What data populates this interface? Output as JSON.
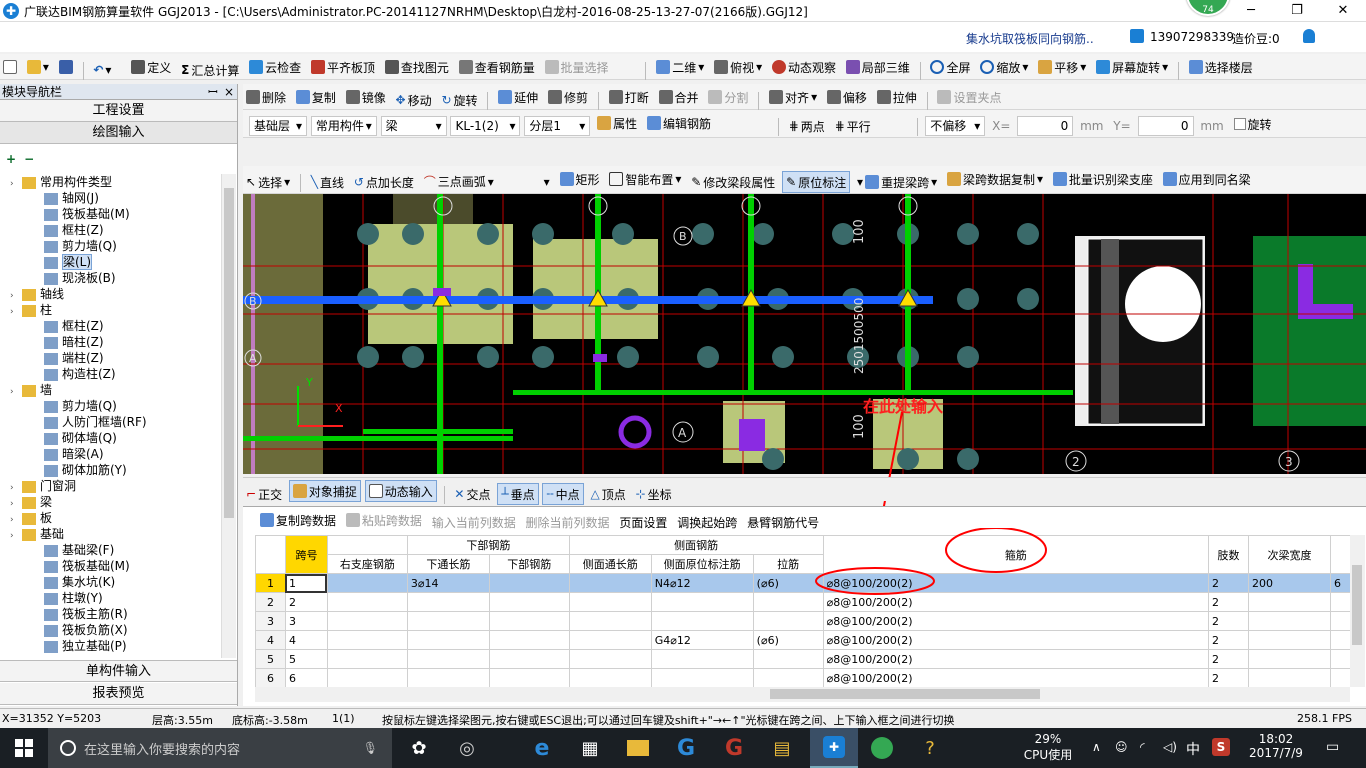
{
  "window": {
    "title": "广联达BIM钢筋算量软件 GGJ2013 - [C:\\Users\\Administrator.PC-20141127NRHM\\Desktop\\白龙村-2016-08-25-13-27-07(2166版).GGJ12]",
    "badge": "74",
    "minimize": "─",
    "restore": "❐",
    "close": "✕"
  },
  "info": {
    "link": "集水坑取筏板同向钢筋..",
    "phone": "13907298339",
    "beans": "造价豆:0"
  },
  "toolbar1": [
    {
      "label": "定义"
    },
    {
      "label": "汇总计算"
    },
    {
      "label": "云检查"
    },
    {
      "label": "平齐板顶"
    },
    {
      "label": "查找图元"
    },
    {
      "label": "查看钢筋量"
    },
    {
      "label": "批量选择"
    },
    {
      "label": "二维"
    },
    {
      "label": "俯视"
    },
    {
      "label": "动态观察"
    },
    {
      "label": "局部三维"
    },
    {
      "label": "全屏"
    },
    {
      "label": "缩放"
    },
    {
      "label": "平移"
    },
    {
      "label": "屏幕旋转"
    },
    {
      "label": "选择楼层"
    }
  ],
  "toolbar2": [
    {
      "label": "删除"
    },
    {
      "label": "复制"
    },
    {
      "label": "镜像"
    },
    {
      "label": "移动"
    },
    {
      "label": "旋转"
    },
    {
      "label": "延伸"
    },
    {
      "label": "修剪"
    },
    {
      "label": "打断"
    },
    {
      "label": "合并"
    },
    {
      "label": "分割"
    },
    {
      "label": "对齐"
    },
    {
      "label": "偏移"
    },
    {
      "label": "拉伸"
    },
    {
      "label": "设置夹点"
    }
  ],
  "toolbar3": {
    "floor": "基础层",
    "category": "常用构件",
    "type": "梁",
    "element": "KL-1(2)",
    "layer": "分层1",
    "props": "属性",
    "edit": "编辑钢筋",
    "twopoint": "两点",
    "parallel": "平行",
    "offset_mode": "不偏移",
    "x_label": "X=",
    "x_val": "0",
    "y_label": "Y=",
    "y_val": "0",
    "unit": "mm",
    "rotate": "旋转"
  },
  "toolbar4": [
    {
      "label": "选择"
    },
    {
      "label": "直线"
    },
    {
      "label": "点加长度"
    },
    {
      "label": "三点画弧"
    },
    {
      "label": "矩形"
    },
    {
      "label": "智能布置"
    },
    {
      "label": "修改梁段属性"
    },
    {
      "label": "原位标注"
    },
    {
      "label": "重提梁跨"
    },
    {
      "label": "梁跨数据复制"
    },
    {
      "label": "批量识别梁支座"
    },
    {
      "label": "应用到同名梁"
    }
  ],
  "leftpanel": {
    "header": "模块导航栏",
    "pin": "ꟷ",
    "close": "×",
    "eng_settings": "工程设置",
    "draw_input": "绘图输入",
    "single_input": "单构件输入",
    "report": "报表预览",
    "tree": [
      {
        "label": "常用构件类型",
        "level": 0,
        "folder": true
      },
      {
        "label": "轴网(J)",
        "level": 1
      },
      {
        "label": "筏板基础(M)",
        "level": 1
      },
      {
        "label": "框柱(Z)",
        "level": 1
      },
      {
        "label": "剪力墙(Q)",
        "level": 1
      },
      {
        "label": "梁(L)",
        "level": 1,
        "selected": true
      },
      {
        "label": "现浇板(B)",
        "level": 1
      },
      {
        "label": "轴线",
        "level": 0,
        "folder": true
      },
      {
        "label": "柱",
        "level": 0,
        "folder": true
      },
      {
        "label": "框柱(Z)",
        "level": 1
      },
      {
        "label": "暗柱(Z)",
        "level": 1
      },
      {
        "label": "端柱(Z)",
        "level": 1
      },
      {
        "label": "构造柱(Z)",
        "level": 1
      },
      {
        "label": "墙",
        "level": 0,
        "folder": true
      },
      {
        "label": "剪力墙(Q)",
        "level": 1
      },
      {
        "label": "人防门框墙(RF)",
        "level": 1
      },
      {
        "label": "砌体墙(Q)",
        "level": 1
      },
      {
        "label": "暗梁(A)",
        "level": 1
      },
      {
        "label": "砌体加筋(Y)",
        "level": 1
      },
      {
        "label": "门窗洞",
        "level": 0,
        "folder": true
      },
      {
        "label": "梁",
        "level": 0,
        "folder": true
      },
      {
        "label": "板",
        "level": 0,
        "folder": true
      },
      {
        "label": "基础",
        "level": 0,
        "folder": true
      },
      {
        "label": "基础梁(F)",
        "level": 1
      },
      {
        "label": "筏板基础(M)",
        "level": 1
      },
      {
        "label": "集水坑(K)",
        "level": 1
      },
      {
        "label": "柱墩(Y)",
        "level": 1
      },
      {
        "label": "筏板主筋(R)",
        "level": 1
      },
      {
        "label": "筏板负筋(X)",
        "level": 1
      },
      {
        "label": "独立基础(P)",
        "level": 1
      }
    ]
  },
  "canvas": {
    "annotation": "在此处输入",
    "axis_labels": [
      "B",
      "A",
      "A",
      "B",
      "2",
      "3",
      "100",
      "100",
      "2501500500"
    ],
    "x_axis": "X",
    "y_axis": "Y"
  },
  "snapbar": [
    {
      "label": "正交"
    },
    {
      "label": "对象捕捉"
    },
    {
      "label": "动态输入"
    },
    {
      "label": "交点"
    },
    {
      "label": "垂点"
    },
    {
      "label": "中点"
    },
    {
      "label": "顶点"
    },
    {
      "label": "坐标"
    }
  ],
  "tabletools": [
    {
      "label": "复制跨数据"
    },
    {
      "label": "粘贴跨数据"
    },
    {
      "label": "输入当前列数据"
    },
    {
      "label": "删除当前列数据"
    },
    {
      "label": "页面设置"
    },
    {
      "label": "调换起始跨"
    },
    {
      "label": "悬臂钢筋代号"
    }
  ],
  "table": {
    "group_headers": {
      "bottom": "下部钢筋",
      "side": "侧面钢筋",
      "stirrup": "箍筋",
      "legs": "肢数",
      "sub_width": "次梁宽度"
    },
    "headers": [
      "跨号",
      "右支座钢筋",
      "下通长筋",
      "下部钢筋",
      "侧面通长筋",
      "侧面原位标注筋",
      "拉筋"
    ],
    "rows": [
      {
        "idx": "1",
        "span": "1",
        "right": "",
        "bottom_thru": "3⌀14",
        "bottom": "",
        "side_thru": "",
        "side_in": "N4⌀12",
        "tie": "(⌀6)",
        "stirrup": "⌀8@100/200(2)",
        "legs": "2",
        "sub_w": "200",
        "extra": "6"
      },
      {
        "idx": "2",
        "span": "2",
        "right": "",
        "bottom_thru": "",
        "bottom": "",
        "side_thru": "",
        "side_in": "",
        "tie": "",
        "stirrup": "⌀8@100/200(2)",
        "legs": "2",
        "sub_w": "",
        "extra": ""
      },
      {
        "idx": "3",
        "span": "3",
        "right": "",
        "bottom_thru": "",
        "bottom": "",
        "side_thru": "",
        "side_in": "",
        "tie": "",
        "stirrup": "⌀8@100/200(2)",
        "legs": "2",
        "sub_w": "",
        "extra": ""
      },
      {
        "idx": "4",
        "span": "4",
        "right": "",
        "bottom_thru": "",
        "bottom": "",
        "side_thru": "",
        "side_in": "G4⌀12",
        "tie": "(⌀6)",
        "stirrup": "⌀8@100/200(2)",
        "legs": "2",
        "sub_w": "",
        "extra": ""
      },
      {
        "idx": "5",
        "span": "5",
        "right": "",
        "bottom_thru": "",
        "bottom": "",
        "side_thru": "",
        "side_in": "",
        "tie": "",
        "stirrup": "⌀8@100/200(2)",
        "legs": "2",
        "sub_w": "",
        "extra": ""
      },
      {
        "idx": "6",
        "span": "6",
        "right": "",
        "bottom_thru": "",
        "bottom": "",
        "side_thru": "",
        "side_in": "",
        "tie": "",
        "stirrup": "⌀8@100/200(2)",
        "legs": "2",
        "sub_w": "",
        "extra": ""
      }
    ]
  },
  "status": {
    "coords": "X=31352 Y=5203",
    "floor_h": "层高:3.55m",
    "bottom_h": "底标高:-3.58m",
    "count": "1(1)",
    "hint": "按鼠标左键选择梁图元,按右键或ESC退出;可以通过回车键及shift+\"→←↑\"光标键在跨之间、上下输入框之间进行切换",
    "fps": "258.1 FPS"
  },
  "taskbar": {
    "search_placeholder": "在这里输入你要搜索的内容",
    "cpu_pct": "29%",
    "cpu_label": "CPU使用",
    "ime": "中",
    "time": "18:02",
    "date": "2017/7/9"
  },
  "colors": {
    "accent": "#1a7fd4",
    "annotation": "#ff0000",
    "selection": "#a8c8ec",
    "canvas_bg": "#000000"
  }
}
